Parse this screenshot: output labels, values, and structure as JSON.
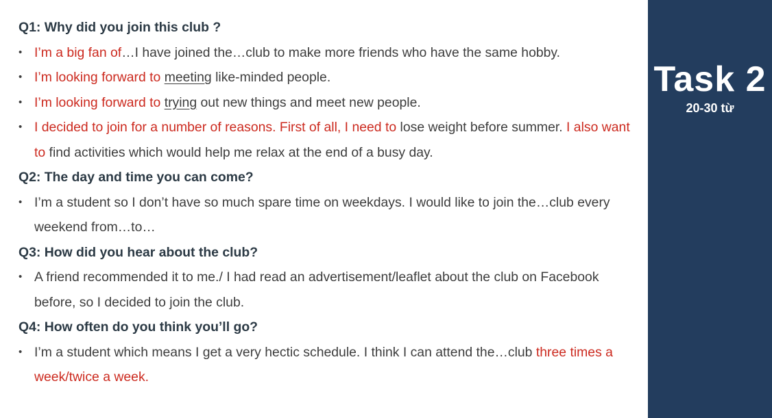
{
  "questions": [
    {
      "heading": "Q1: Why did you join this club ?",
      "items": [
        [
          {
            "text": "I’m a big fan of",
            "style": "red"
          },
          {
            "text": "…I have joined the…club to make more friends who have the same hobby."
          }
        ],
        [
          {
            "text": "I’m looking forward to ",
            "style": "red"
          },
          {
            "text": "meeting",
            "style": "underline"
          },
          {
            "text": " like-minded people."
          }
        ],
        [
          {
            "text": "I’m looking forward to ",
            "style": "red"
          },
          {
            "text": "trying",
            "style": "underline"
          },
          {
            "text": " out new things and meet new people."
          }
        ],
        [
          {
            "text": "I decided to join for a number of reasons. First of all, I need to",
            "style": "red"
          },
          {
            "text": " lose weight before summer. "
          },
          {
            "text": "I also want to",
            "style": "red"
          },
          {
            "text": " find activities which would help me relax at the end of a busy day."
          }
        ]
      ]
    },
    {
      "heading": "Q2: The day and time you can come?",
      "items": [
        [
          {
            "text": "I’m a student so I don’t have so much spare time on weekdays. I would like to join the…club every weekend from…to…"
          }
        ]
      ]
    },
    {
      "heading": "Q3: How did you hear about the club?",
      "items": [
        [
          {
            "text": "A friend recommended it to me./ I had read an advertisement/leaflet about the club on Facebook before, so I decided to join the club."
          }
        ]
      ]
    },
    {
      "heading": "Q4: How often do you think you’ll go?",
      "items": [
        [
          {
            "text": "I’m a student which means I get a very hectic schedule. I think I can attend the…club "
          },
          {
            "text": "three times a week/twice a week.",
            "style": "red"
          }
        ]
      ]
    }
  ],
  "bullet": "•",
  "side_panel": {
    "title": "Task 2",
    "subtitle": "20-30 từ",
    "background": "#233d5e"
  },
  "colors": {
    "highlight": "#cc2a1f",
    "heading": "#2c3a45",
    "body": "#3d3d3d"
  }
}
